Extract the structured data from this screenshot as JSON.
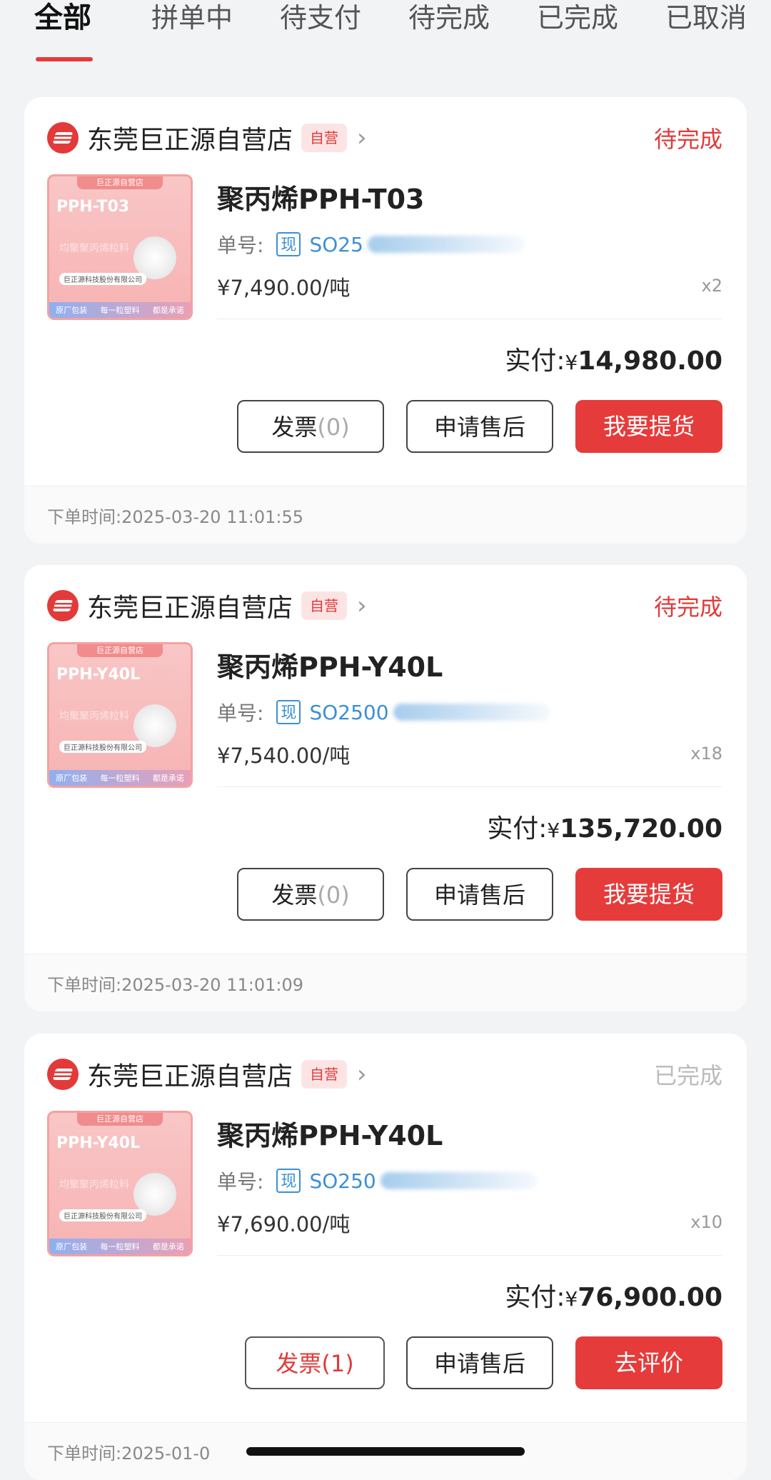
{
  "tabs": [
    "全部",
    "拼单中",
    "待支付",
    "待完成",
    "已完成",
    "已取消"
  ],
  "orders": [
    {
      "shop": "东莞巨正源自营店",
      "badge": "自营",
      "status": "待完成",
      "thumb_tag": "巨正源自营店",
      "thumb_name": "PPH-T03",
      "thumb_sub": "均聚聚丙烯粒料",
      "thumb_co": "巨正源科技股份有限公司",
      "thumb_bottom": [
        "原厂包装",
        "每一粒塑料",
        "都是承诺"
      ],
      "title": "聚丙烯PPH-T03",
      "order_label": "单号:",
      "now_badge": "现",
      "order_no": "SO25",
      "price": "¥7,490.00/吨",
      "qty": "x2",
      "paid_label": "实付:",
      "paid_currency": "¥",
      "paid_amount": "14,980.00",
      "btn_invoice": "发票",
      "btn_invoice_count": "(0)",
      "btn_aftersale": "申请售后",
      "btn_action": "我要提货",
      "time": "下单时间:2025-03-20 11:01:55"
    },
    {
      "shop": "东莞巨正源自营店",
      "badge": "自营",
      "status": "待完成",
      "thumb_tag": "巨正源自营店",
      "thumb_name": "PPH-Y40L",
      "thumb_sub": "均聚聚丙烯粒料",
      "thumb_co": "巨正源科技股份有限公司",
      "thumb_bottom": [
        "原厂包装",
        "每一粒塑料",
        "都是承诺"
      ],
      "title": "聚丙烯PPH-Y40L",
      "order_label": "单号:",
      "now_badge": "现",
      "order_no": "SO2500",
      "price": "¥7,540.00/吨",
      "qty": "x18",
      "paid_label": "实付:",
      "paid_currency": "¥",
      "paid_amount": "135,720.00",
      "btn_invoice": "发票",
      "btn_invoice_count": "(0)",
      "btn_aftersale": "申请售后",
      "btn_action": "我要提货",
      "time": "下单时间:2025-03-20 11:01:09"
    },
    {
      "shop": "东莞巨正源自营店",
      "badge": "自营",
      "status": "已完成",
      "thumb_tag": "巨正源自营店",
      "thumb_name": "PPH-Y40L",
      "thumb_sub": "均聚聚丙烯粒料",
      "thumb_co": "巨正源科技股份有限公司",
      "thumb_bottom": [
        "原厂包装",
        "每一粒塑料",
        "都是承诺"
      ],
      "title": "聚丙烯PPH-Y40L",
      "order_label": "单号:",
      "now_badge": "现",
      "order_no": "SO250",
      "price": "¥7,690.00/吨",
      "qty": "x10",
      "paid_label": "实付:",
      "paid_currency": "¥",
      "paid_amount": "76,900.00",
      "btn_invoice": "发票",
      "btn_invoice_count": "(1)",
      "btn_aftersale": "申请售后",
      "btn_action": "去评价",
      "time": "下单时间:2025-01-0"
    }
  ],
  "colors": {
    "accent": "#e63b3b",
    "link": "#3b8fd6",
    "bg": "#f2f3f5"
  }
}
